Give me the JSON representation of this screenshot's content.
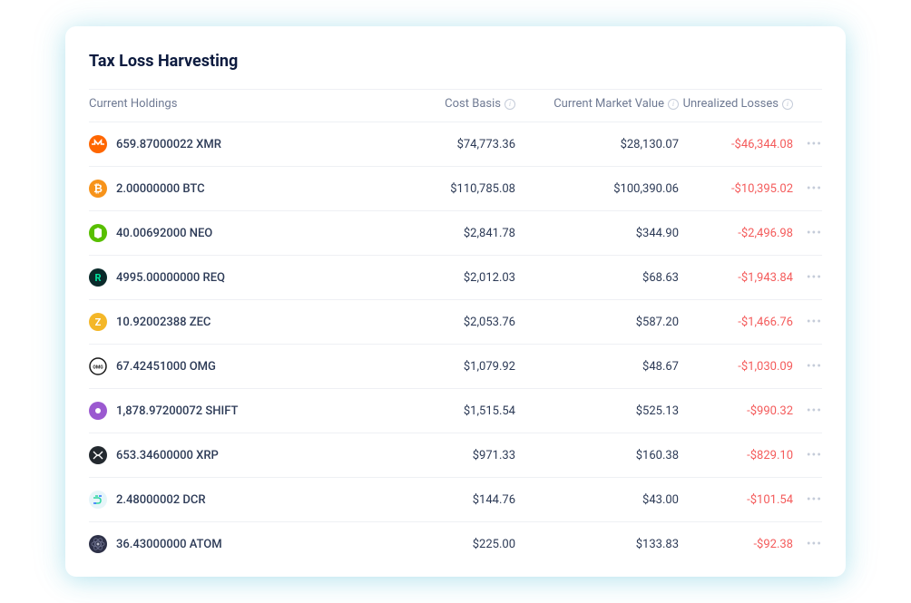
{
  "title": "Tax Loss Harvesting",
  "headers": {
    "holdings": "Current Holdings",
    "costBasis": "Cost Basis",
    "marketValue": "Current Market Value",
    "unrealizedLosses": "Unrealized Losses"
  },
  "rows": [
    {
      "icon": "xmr",
      "amount": "659.87000022 XMR",
      "cost": "$74,773.36",
      "market": "$28,130.07",
      "loss": "-$46,344.08"
    },
    {
      "icon": "btc",
      "amount": "2.00000000  BTC",
      "cost": "$110,785.08",
      "market": "$100,390.06",
      "loss": "-$10,395.02"
    },
    {
      "icon": "neo",
      "amount": "40.00692000 NEO",
      "cost": "$2,841.78",
      "market": "$344.90",
      "loss": "-$2,496.98"
    },
    {
      "icon": "req",
      "amount": "4995.00000000 REQ",
      "cost": "$2,012.03",
      "market": "$68.63",
      "loss": "-$1,943.84"
    },
    {
      "icon": "zec",
      "amount": "10.92002388 ZEC",
      "cost": "$2,053.76",
      "market": "$587.20",
      "loss": "-$1,466.76"
    },
    {
      "icon": "omg",
      "amount": "67.42451000 OMG",
      "cost": "$1,079.92",
      "market": "$48.67",
      "loss": "-$1,030.09"
    },
    {
      "icon": "shift",
      "amount": "1,878.97200072 SHIFT",
      "cost": "$1,515.54",
      "market": "$525.13",
      "loss": "-$990.32"
    },
    {
      "icon": "xrp",
      "amount": "653.34600000 XRP",
      "cost": "$971.33",
      "market": "$160.38",
      "loss": "-$829.10"
    },
    {
      "icon": "dcr",
      "amount": "2.48000002 DCR",
      "cost": "$144.76",
      "market": "$43.00",
      "loss": "-$101.54"
    },
    {
      "icon": "atom",
      "amount": "36.43000000 ATOM",
      "cost": "$225.00",
      "market": "$133.83",
      "loss": "-$92.38"
    }
  ]
}
